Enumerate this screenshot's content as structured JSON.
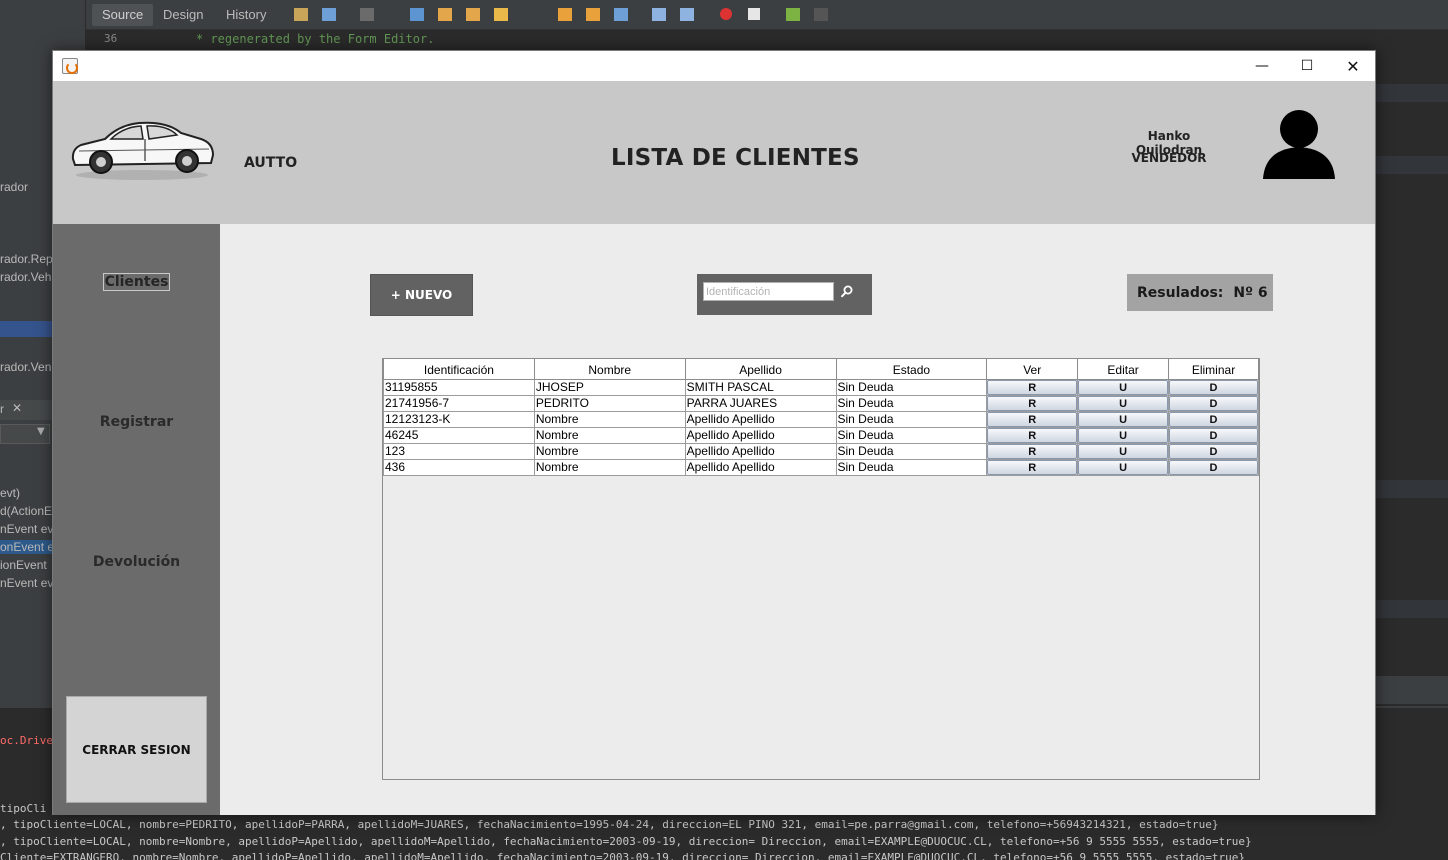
{
  "ide": {
    "tabs": [
      "Source",
      "Design",
      "History"
    ],
    "line_number": "36",
    "code_line": "* regenerated by the Form Editor.",
    "left_fragments": [
      "rador",
      "rador.Rep",
      "rador.Veh",
      "rador.Ven",
      "r",
      "evt)",
      "d(ActionE",
      "nEvent evt",
      "onEvent e",
      "ionEvent",
      "nEvent ev"
    ],
    "console": [
      "oc.Drive",
      "tipoCli",
      ", tipoCliente=LOCAL, nombre=PEDRITO, apellidoP=PARRA, apellidoM=JUARES, fechaNacimiento=1995-04-24, direccion=EL PINO 321, email=pe.parra@gmail.com, telefono=+56943214321, estado=true}",
      ", tipoCliente=LOCAL, nombre=Nombre, apellidoP=Apellido, apellidoM=Apellido, fechaNacimiento=2003-09-19, direccion= Direccion, email=EXAMPLE@DUOCUC.CL, telefono=+56  9 5555 5555, estado=true}",
      "Cliente=EXTRANGERO, nombre=Nombre, apellidoP=Apellido, apellidoM=Apellido, fechaNacimiento=2003-09-19, direccion= Direccion, email=EXAMPLE@DUOCUC.CL, telefono=+56  9 5555 5555, estado=true}"
    ]
  },
  "window": {
    "minimize_glyph": "—",
    "maximize_glyph": "☐",
    "close_glyph": "✕"
  },
  "header": {
    "brand": "AUTTO",
    "title": "LISTA DE CLIENTES",
    "user_name": "Hanko Quilodran",
    "user_role": "VENDEDOR"
  },
  "sidebar": {
    "items": [
      {
        "label": "Clientes"
      },
      {
        "label": "Registrar"
      },
      {
        "label": "Devolución"
      }
    ],
    "logout_label": "CERRAR SESION"
  },
  "toolbar": {
    "new_label": "+ NUEVO",
    "search_placeholder": "Identificación",
    "results_label": "Resulados:",
    "results_value": "Nº 6"
  },
  "table": {
    "columns": [
      "Identificación",
      "Nombre",
      "Apellido",
      "Estado",
      "Ver",
      "Editar",
      "Eliminar"
    ],
    "rows": [
      {
        "id": "31195855",
        "nombre": "JHOSEP",
        "apellido": "SMITH PASCAL",
        "estado": "Sin Deuda",
        "ver": "R",
        "editar": "U",
        "eliminar": "D"
      },
      {
        "id": "21741956-7",
        "nombre": "PEDRITO",
        "apellido": "PARRA JUARES",
        "estado": "Sin Deuda",
        "ver": "R",
        "editar": "U",
        "eliminar": "D"
      },
      {
        "id": "12123123-K",
        "nombre": "Nombre",
        "apellido": "Apellido Apellido",
        "estado": "Sin Deuda",
        "ver": "R",
        "editar": "U",
        "eliminar": "D"
      },
      {
        "id": "46245",
        "nombre": "Nombre",
        "apellido": "Apellido Apellido",
        "estado": "Sin Deuda",
        "ver": "R",
        "editar": "U",
        "eliminar": "D"
      },
      {
        "id": "123",
        "nombre": "Nombre",
        "apellido": "Apellido Apellido",
        "estado": "Sin Deuda",
        "ver": "R",
        "editar": "U",
        "eliminar": "D"
      },
      {
        "id": "436",
        "nombre": "Nombre",
        "apellido": "Apellido Apellido",
        "estado": "Sin Deuda",
        "ver": "R",
        "editar": "U",
        "eliminar": "D"
      }
    ]
  },
  "colors": {
    "header_bg": "#c8c8c8",
    "sidebar_bg": "#6b6b6b",
    "content_bg": "#ececec",
    "button_bg": "#626262",
    "results_bg": "#a3a3a3"
  },
  "icons": {
    "logo": "car-logo",
    "avatar": "user-avatar-icon",
    "search": "search-icon"
  }
}
